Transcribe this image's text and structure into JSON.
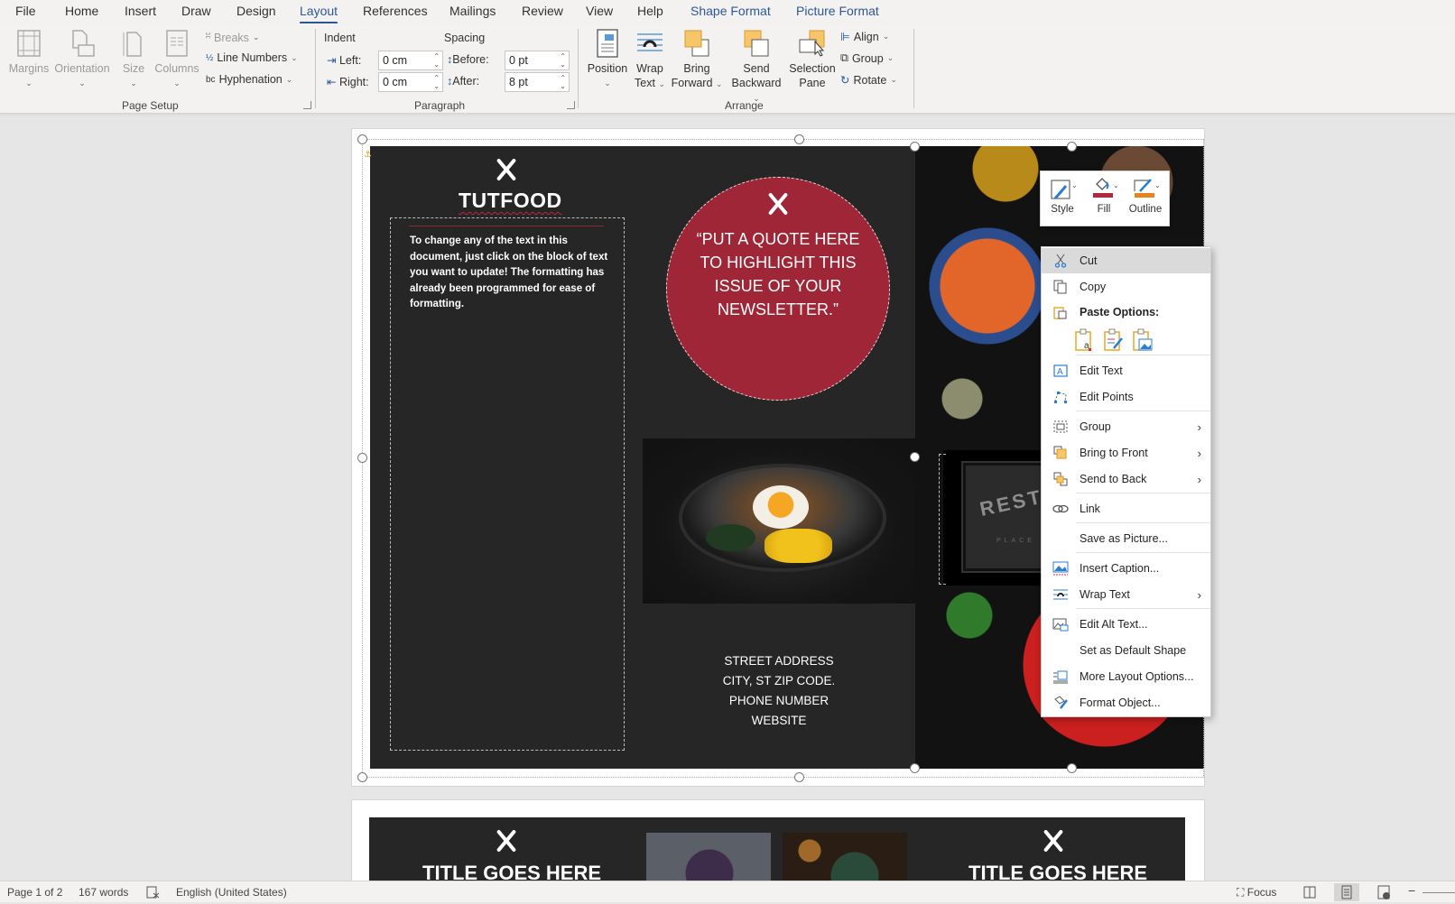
{
  "tabs": [
    {
      "label": "File"
    },
    {
      "label": "Home"
    },
    {
      "label": "Insert"
    },
    {
      "label": "Draw"
    },
    {
      "label": "Design"
    },
    {
      "label": "Layout",
      "active": true
    },
    {
      "label": "References"
    },
    {
      "label": "Mailings"
    },
    {
      "label": "Review"
    },
    {
      "label": "View"
    },
    {
      "label": "Help"
    },
    {
      "label": "Shape Format",
      "contextual": true
    },
    {
      "label": "Picture Format",
      "contextual": true
    }
  ],
  "ribbon": {
    "page_setup": {
      "label": "Page Setup",
      "margins": "Margins",
      "orientation": "Orientation",
      "size": "Size",
      "columns": "Columns",
      "breaks": "Breaks",
      "line_numbers": "Line Numbers",
      "hyphenation": "Hyphenation"
    },
    "paragraph": {
      "label": "Paragraph",
      "indent_heading": "Indent",
      "spacing_heading": "Spacing",
      "left_label": "Left:",
      "left_value": "0 cm",
      "right_label": "Right:",
      "right_value": "0 cm",
      "before_label": "Before:",
      "before_value": "0 pt",
      "after_label": "After:",
      "after_value": "8 pt"
    },
    "arrange": {
      "label": "Arrange",
      "position": "Position",
      "wrap_text_1": "Wrap",
      "wrap_text_2": "Text",
      "bring_forward_1": "Bring",
      "bring_forward_2": "Forward",
      "send_backward_1": "Send",
      "send_backward_2": "Backward",
      "selection_pane_1": "Selection",
      "selection_pane_2": "Pane",
      "align": "Align",
      "group": "Group",
      "rotate": "Rotate"
    }
  },
  "document": {
    "brand": "TUTFOOD",
    "body_text": "To change any of the text in this document, just click on the block of text you want to update!  The formatting has already been programmed for ease of formatting.",
    "quote_lines": [
      "“PUT A QUOTE HERE",
      "TO HIGHLIGHT THIS",
      "ISSUE OF YOUR",
      "NEWSLETTER.”"
    ],
    "address_lines": [
      "STREET ADDRESS",
      "CITY, ST ZIP CODE.",
      "PHONE NUMBER",
      "WEBSITE"
    ],
    "sign_text": "RESTA",
    "sign_sub": "PLACE",
    "page2_title_left": "TITLE GOES HERE",
    "page2_title_right": "TITLE GOES HERE",
    "accent_color": "#9e2637"
  },
  "mini_toolbar": {
    "style": "Style",
    "fill": "Fill",
    "outline": "Outline",
    "fill_color": "#b5263a",
    "outline_color": "#e8821e"
  },
  "context_menu": {
    "cut": "Cut",
    "copy": "Copy",
    "paste_options": "Paste Options:",
    "edit_text": "Edit Text",
    "edit_points": "Edit Points",
    "group": "Group",
    "bring_to_front": "Bring to Front",
    "send_to_back": "Send to Back",
    "link": "Link",
    "save_as_picture": "Save as Picture...",
    "insert_caption": "Insert Caption...",
    "wrap_text": "Wrap Text",
    "edit_alt_text": "Edit Alt Text...",
    "set_default_shape": "Set as Default Shape",
    "more_layout_options": "More Layout Options...",
    "format_object": "Format Object..."
  },
  "status_bar": {
    "page": "Page 1 of 2",
    "words": "167 words",
    "language": "English (United States)",
    "focus": "Focus"
  }
}
